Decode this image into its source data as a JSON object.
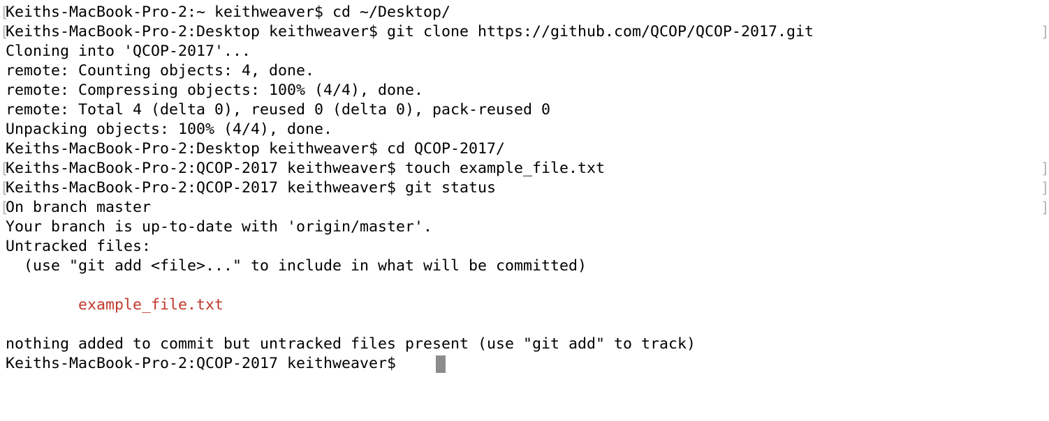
{
  "terminal": {
    "lines": [
      "Keiths-MacBook-Pro-2:~ keithweaver$ cd ~/Desktop/",
      "Keiths-MacBook-Pro-2:Desktop keithweaver$ git clone https://github.com/QCOP/QCOP-2017.git",
      "Cloning into 'QCOP-2017'...",
      "remote: Counting objects: 4, done.",
      "remote: Compressing objects: 100% (4/4), done.",
      "remote: Total 4 (delta 0), reused 0 (delta 0), pack-reused 0",
      "Unpacking objects: 100% (4/4), done.",
      "Keiths-MacBook-Pro-2:Desktop keithweaver$ cd QCOP-2017/",
      "Keiths-MacBook-Pro-2:QCOP-2017 keithweaver$ touch example_file.txt",
      "Keiths-MacBook-Pro-2:QCOP-2017 keithweaver$ git status",
      "On branch master",
      "Your branch is up-to-date with 'origin/master'.",
      "Untracked files:",
      "  (use \"git add <file>...\" to include in what will be committed)",
      "",
      "        example_file.txt",
      "",
      "nothing added to commit but untracked files present (use \"git add\" to track)",
      "Keiths-MacBook-Pro-2:QCOP-2017 keithweaver$ "
    ],
    "bracket_left": "[",
    "bracket_right": "]",
    "untracked_color": "#c0392b",
    "cursor_color": "#8c8c8c"
  }
}
